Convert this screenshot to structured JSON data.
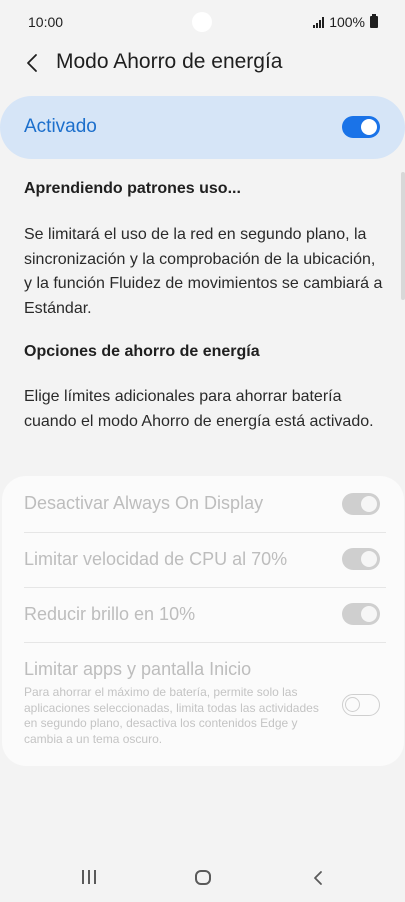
{
  "status_bar": {
    "time": "10:00",
    "battery": "100%"
  },
  "header": {
    "title": "Modo Ahorro de energía"
  },
  "master": {
    "label": "Activado",
    "enabled": true
  },
  "learning": {
    "title": "Aprendiendo patrones uso...",
    "body": "Se limitará el uso de la red en segundo plano, la sincronización y la comprobación de la ubicación, y la función Fluidez de movimientos se cambiará a Estándar."
  },
  "options_section": {
    "title": "Opciones de ahorro de energía",
    "body": "Elige límites adicionales para ahorrar batería cuando el modo Ahorro de energía está activado."
  },
  "options": [
    {
      "label": "Desactivar Always On Display",
      "state": "on-disabled"
    },
    {
      "label": "Limitar velocidad de CPU al 70%",
      "state": "on-disabled"
    },
    {
      "label": "Reducir brillo en 10%",
      "state": "on-disabled"
    },
    {
      "label": "Limitar apps y pantalla Inicio",
      "description": "Para ahorrar el máximo de batería, permite solo las aplicaciones seleccionadas, limita todas las actividades en segundo plano, desactiva los contenidos Edge y cambia a un tema oscuro.",
      "state": "off-disabled"
    }
  ],
  "icons": {
    "back": "back-arrow-icon",
    "signal": "signal-icon",
    "battery": "battery-icon",
    "nav_recents": "recents-icon",
    "nav_home": "home-icon",
    "nav_back": "nav-back-icon"
  },
  "colors": {
    "accent": "#1a73e8",
    "master_card": "#d6e5f7",
    "master_label": "#1c6fcc"
  }
}
